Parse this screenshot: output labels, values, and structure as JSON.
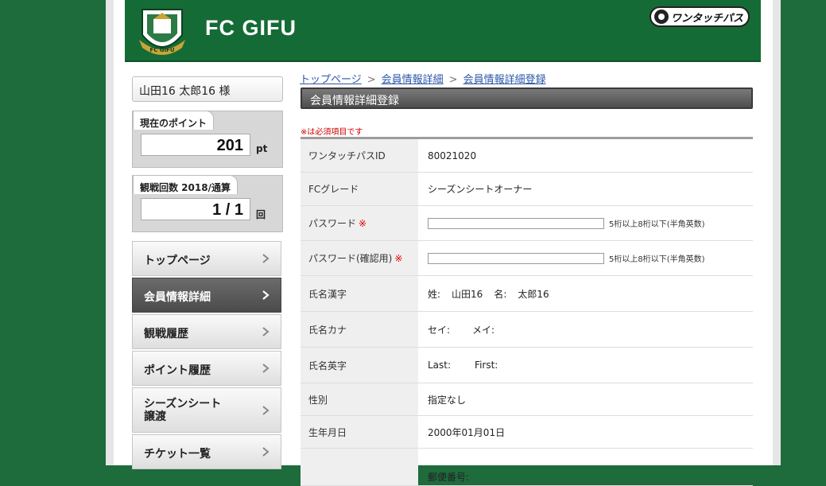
{
  "header": {
    "club_name": "FC GIFU",
    "crest_text": "FC GIFU",
    "partner_logo_text": "ワンタッチパス"
  },
  "sidebar": {
    "user_name": "山田16 太郎16 様",
    "points": {
      "label": "現在のポイント",
      "value": "201",
      "unit": "pt"
    },
    "visits": {
      "label": "観戦回数 2018/通算",
      "value": "1 / 1",
      "unit": "回"
    },
    "nav": [
      {
        "label": "トップページ",
        "active": false
      },
      {
        "label": "会員情報詳細",
        "active": true
      },
      {
        "label": "観戦履歴",
        "active": false
      },
      {
        "label": "ポイント履歴",
        "active": false
      },
      {
        "label_line1": "シーズンシート",
        "label_line2": "譲渡",
        "active": false
      },
      {
        "label": "チケット一覧",
        "active": false
      }
    ]
  },
  "main": {
    "breadcrumb": [
      "トップページ",
      "会員情報詳細",
      "会員情報詳細登録"
    ],
    "section_title": "会員情報詳細登録",
    "required_note": "※は必須項目です",
    "required_mark": "※",
    "rows": {
      "pass_id": {
        "label": "ワンタッチパスID",
        "value": "80021020"
      },
      "grade": {
        "label": "FCグレード",
        "value": "シーズンシートオーナー"
      },
      "password": {
        "label": "パスワード",
        "hint": "5桁以上8桁以下(半角英数)"
      },
      "password_confirm": {
        "label": "パスワード(確認用)",
        "hint": "5桁以上8桁以下(半角英数)"
      },
      "kanji_name": {
        "label": "氏名漢字",
        "sei_label": "姓:",
        "sei": "山田16",
        "mei_label": "名:",
        "mei": "太郎16"
      },
      "kana_name": {
        "label": "氏名カナ",
        "sei_label": "セイ:",
        "mei_label": "メイ:"
      },
      "english_name": {
        "label": "氏名英字",
        "last_label": "Last:",
        "first_label": "First:"
      },
      "gender": {
        "label": "性別",
        "value": "指定なし"
      },
      "birthday": {
        "label": "生年月日",
        "value": "2000年01月01日"
      },
      "address": {
        "label": "",
        "postal_label": "郵便番号:"
      }
    }
  },
  "colors": {
    "background": "#1e6b3c",
    "header": "#156b35",
    "active_nav": "#555555",
    "link": "#2b56a8",
    "required": "#dd0000"
  }
}
